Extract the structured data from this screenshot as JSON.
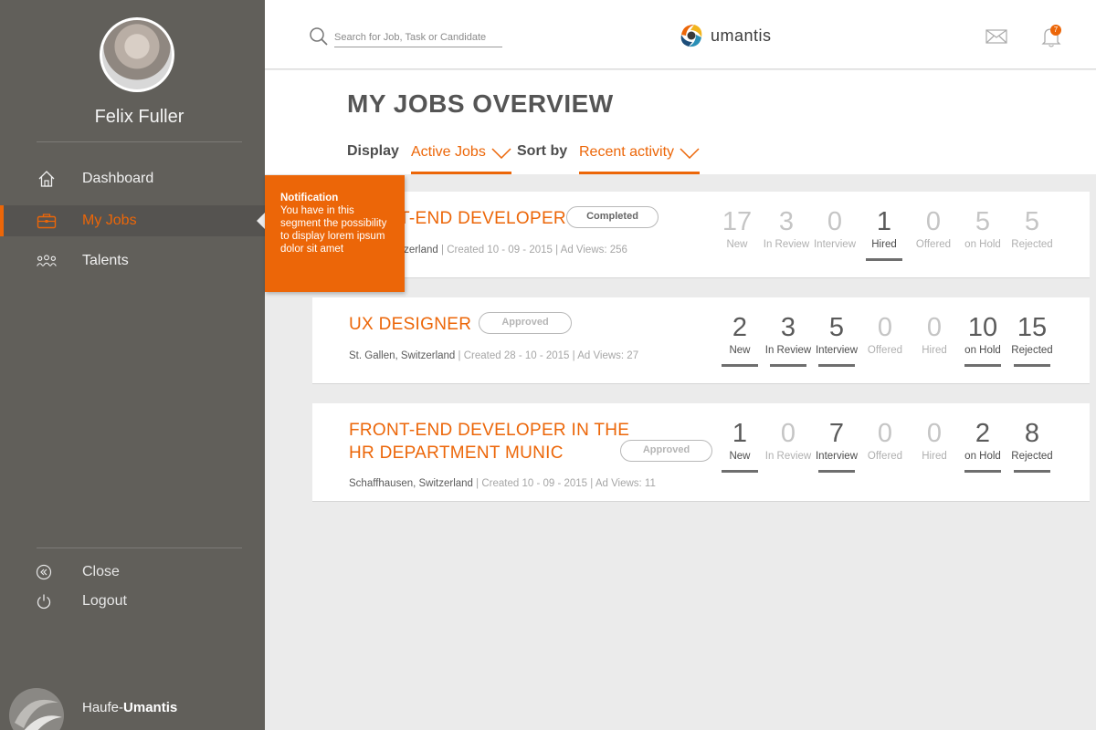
{
  "user": {
    "name": "Felix Fuller"
  },
  "nav": [
    {
      "label": "Dashboard",
      "icon": "home-icon",
      "active": false
    },
    {
      "label": "My Jobs",
      "icon": "briefcase-icon",
      "active": true
    },
    {
      "label": "Talents",
      "icon": "people-icon",
      "active": false
    }
  ],
  "bottom_nav": {
    "close": "Close",
    "logout": "Logout"
  },
  "brand": {
    "prefix": "Haufe-",
    "name": "Umantis"
  },
  "header": {
    "search_placeholder": "Search for Job, Task or Candidate",
    "logo_text": "umantis",
    "notification_count": "7"
  },
  "page": {
    "title": "MY JOBS OVERVIEW",
    "display_label": "Display",
    "display_value": "Active Jobs",
    "sort_label": "Sort by",
    "sort_value": "Recent activity"
  },
  "tooltip": {
    "title": "Notification",
    "body": "You have in this segment the possibility to display lorem ipsum dolor sit amet"
  },
  "jobs": [
    {
      "title": "FRONT-END DEVELOPER",
      "status": "Completed",
      "location": "Zurich, Switzerland",
      "details": "Created 10 - 09 - 2015 | Ad Views: 256",
      "stats": [
        {
          "value": "17",
          "label": "New"
        },
        {
          "value": "3",
          "label": "In Review"
        },
        {
          "value": "0",
          "label": "Interview"
        },
        {
          "value": "1",
          "label": "Hired"
        },
        {
          "value": "0",
          "label": "Offered"
        },
        {
          "value": "5",
          "label": "on Hold"
        },
        {
          "value": "5",
          "label": "Rejected"
        }
      ]
    },
    {
      "title": "UX DESIGNER",
      "status": "Approved",
      "location": "St. Gallen, Switzerland",
      "details": "Created 28 - 10 - 2015 | Ad Views: 27",
      "stats": [
        {
          "value": "2",
          "label": "New"
        },
        {
          "value": "3",
          "label": "In Review"
        },
        {
          "value": "5",
          "label": "Interview"
        },
        {
          "value": "0",
          "label": "Offered"
        },
        {
          "value": "0",
          "label": "Hired"
        },
        {
          "value": "10",
          "label": "on Hold"
        },
        {
          "value": "15",
          "label": "Rejected"
        }
      ]
    },
    {
      "title_line1": "FRONT-END DEVELOPER IN THE",
      "title_line2": "HR DEPARTMENT MUNIC",
      "status": "Approved",
      "location": "Schaffhausen, Switzerland",
      "details": "Created 10 - 09 - 2015 | Ad Views: 11",
      "stats": [
        {
          "value": "1",
          "label": "New"
        },
        {
          "value": "0",
          "label": "In Review"
        },
        {
          "value": "7",
          "label": "Interview"
        },
        {
          "value": "0",
          "label": "Offered"
        },
        {
          "value": "0",
          "label": "Hired"
        },
        {
          "value": "2",
          "label": "on Hold"
        },
        {
          "value": "8",
          "label": "Rejected"
        }
      ]
    }
  ],
  "colors": {
    "accent": "#ec6608",
    "sidebar": "#615f5a",
    "background": "#ebebeb"
  }
}
